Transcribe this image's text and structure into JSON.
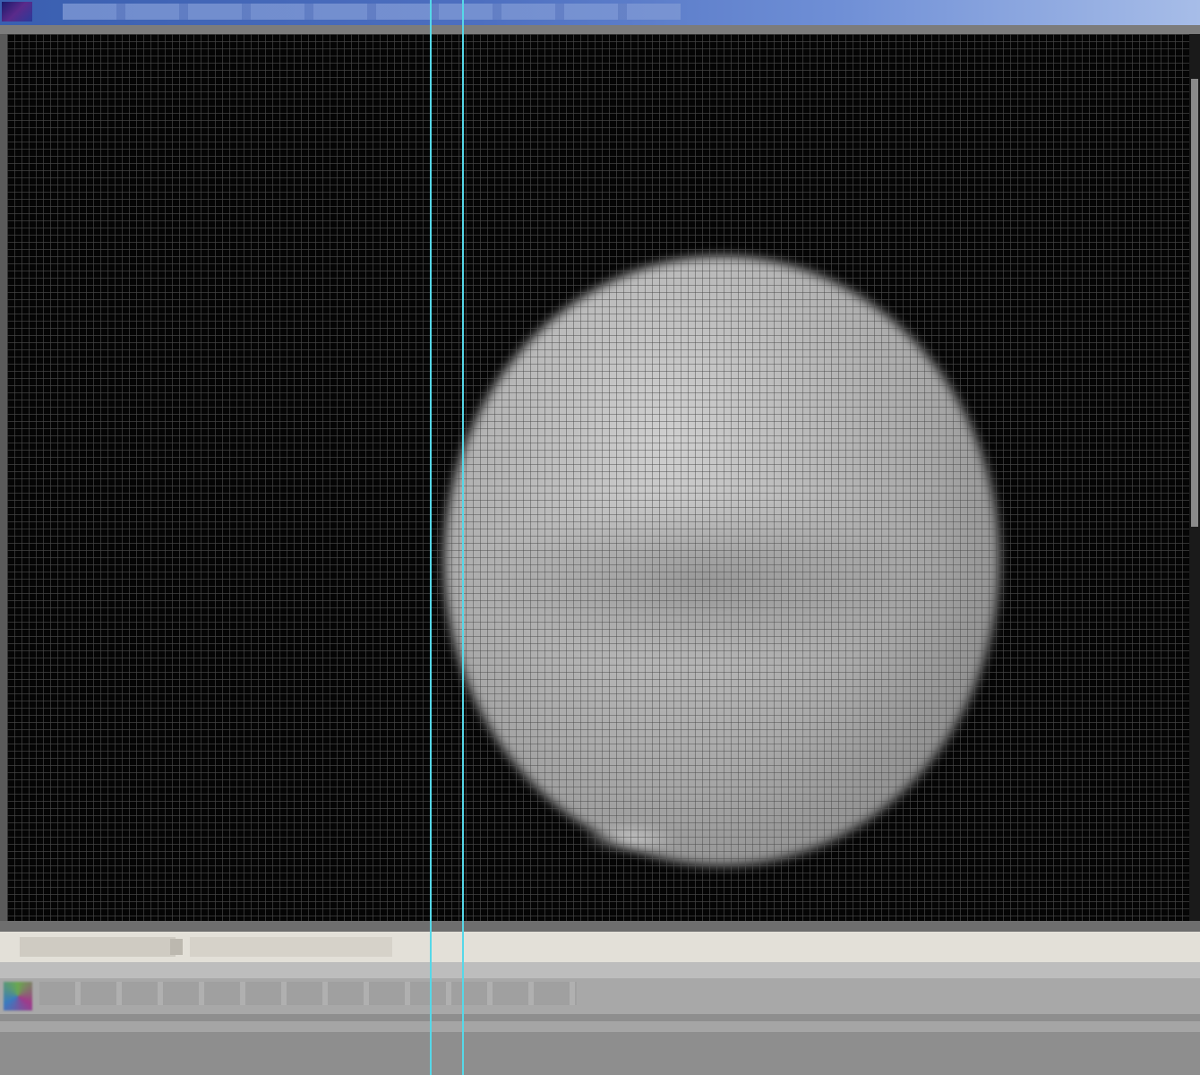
{
  "window": {
    "title": ""
  },
  "tabs": [
    {
      "label": ""
    },
    {
      "label": ""
    },
    {
      "label": ""
    }
  ],
  "message": {
    "text": ""
  },
  "colors": {
    "title_bar": "#4d6fc0",
    "viewport_background": "#050505",
    "guide_lines": "#56d8e8",
    "tab_bar": "#e3e0d8"
  },
  "icons": {
    "app": "app-icon",
    "palette": "palette-icon"
  }
}
